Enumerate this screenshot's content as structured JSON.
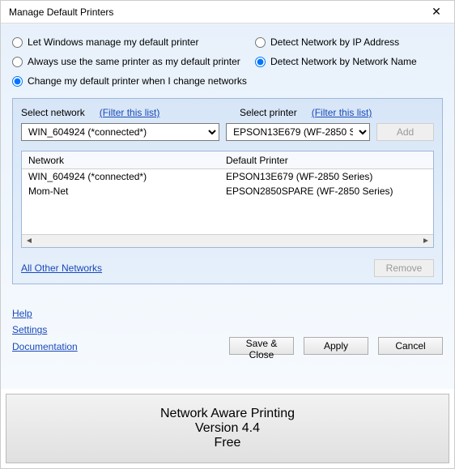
{
  "window": {
    "title": "Manage Default Printers",
    "close_glyph": "✕"
  },
  "radios": {
    "r1": "Let Windows manage my default printer",
    "r2": "Always use the same printer as my default printer",
    "r3": "Change my default printer when I change networks",
    "r4": "Detect Network by IP Address",
    "r5": "Detect Network by Network Name",
    "selected_left": "r3",
    "selected_right": "r5"
  },
  "panel": {
    "select_network_label": "Select network",
    "select_printer_label": "Select printer",
    "filter_label": "(Filter this list)",
    "network_value": "WIN_604924 (*connected*)",
    "printer_value": "EPSON13E679 (WF-2850 Series)",
    "add_label": "Add"
  },
  "table": {
    "col_network": "Network",
    "col_default": "Default Printer",
    "rows": [
      {
        "network": "WIN_604924 (*connected*)",
        "printer": "EPSON13E679 (WF-2850 Series)"
      },
      {
        "network": "Mom-Net",
        "printer": "EPSON2850SPARE (WF-2850 Series)"
      }
    ],
    "scroll_left": "◄",
    "scroll_right": "►"
  },
  "below": {
    "all_other": "All Other Networks",
    "remove": "Remove"
  },
  "links": {
    "help": "Help",
    "settings": "Settings",
    "documentation": "Documentation"
  },
  "buttons": {
    "save_close": "Save & Close",
    "apply": "Apply",
    "cancel": "Cancel"
  },
  "banner": {
    "line1": "Network Aware Printing",
    "line2": "Version 4.4",
    "line3": "Free"
  }
}
